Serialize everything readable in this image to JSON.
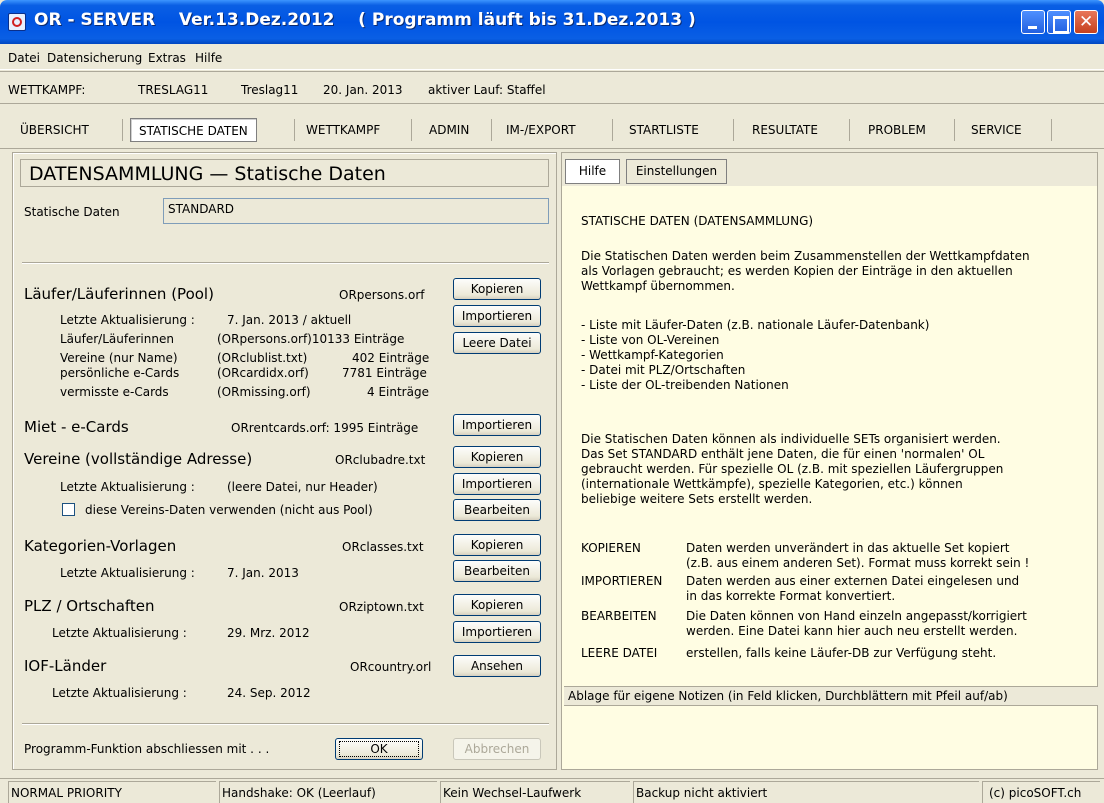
{
  "window": {
    "title": "OR - SERVER    Ver.13.Dez.2012    ( Programm läuft bis 31.Dez.2013 )"
  },
  "menu": [
    "Datei",
    "Datensicherung",
    "Extras",
    "Hilfe"
  ],
  "info": {
    "wettkampf_label": "WETTKAMPF:",
    "code": "TRESLAG11",
    "name": "Treslag11",
    "date": "20. Jan. 2013",
    "active_run": "aktiver Lauf: Staffel"
  },
  "tabs": [
    "ÜBERSICHT",
    "STATISCHE DATEN",
    "WETTKAMPF",
    "ADMIN",
    "IM-/EXPORT",
    "STARTLISTE",
    "RESULTATE",
    "PROBLEM",
    "SERVICE"
  ],
  "left": {
    "title": "DATENSAMMLUNG — Statische Daten",
    "static_label": "Statische Daten",
    "static_value": "STANDARD",
    "runners": {
      "heading": "Läufer/Läuferinnen (Pool)",
      "file": "ORpersons.orf",
      "update_label": "Letzte Aktualisierung :",
      "update_value": "7. Jan. 2013 / aktuell",
      "rows": [
        {
          "label": "Läufer/Läuferinnen",
          "file": "(ORpersons.orf)10133 Einträge"
        },
        {
          "label": "Vereine (nur Name)",
          "file": "(ORclublist.txt)",
          "count": "402 Einträge"
        },
        {
          "label": "persönliche e-Cards",
          "file": "(ORcardidx.orf)",
          "count": "7781 Einträge"
        },
        {
          "label": "vermisste e-Cards",
          "file": "(ORmissing.orf)",
          "count": "4 Einträge"
        }
      ]
    },
    "rental": {
      "heading": "Miet - e-Cards",
      "file": "ORrentcards.orf: 1995 Einträge"
    },
    "clubs": {
      "heading": "Vereine (vollständige Adresse)",
      "file": "ORclubadre.txt",
      "update_label": "Letzte Aktualisierung :",
      "update_value": "(leere Datei, nur Header)",
      "checkbox_label": "diese Vereins-Daten verwenden (nicht aus Pool)"
    },
    "categories": {
      "heading": "Kategorien-Vorlagen",
      "file": "ORclasses.txt",
      "update_label": "Letzte Aktualisierung :",
      "update_value": "7. Jan. 2013"
    },
    "plz": {
      "heading": "PLZ / Ortschaften",
      "file": "ORziptown.txt",
      "update_label": "Letzte Aktualisierung :",
      "update_value": "29. Mrz. 2012"
    },
    "iof": {
      "heading": "IOF-Länder",
      "file": "ORcountry.orl",
      "update_label": "Letzte Aktualisierung :",
      "update_value": "24. Sep. 2012"
    },
    "footer_label": "Programm-Funktion abschliessen mit . . .",
    "buttons": {
      "kopieren": "Kopieren",
      "importieren": "Importieren",
      "leere_datei": "Leere Datei",
      "bearbeiten": "Bearbeiten",
      "ansehen": "Ansehen",
      "ok": "OK",
      "abbrechen": "Abbrechen"
    }
  },
  "right": {
    "tabs": [
      "Hilfe",
      "Einstellungen"
    ],
    "help_title": "STATISCHE DATEN (DATENSAMMLUNG)",
    "para1": "Die Statischen Daten werden beim Zusammenstellen der Wettkampfdaten\nals Vorlagen gebraucht; es werden Kopien der Einträge in den aktuellen\nWettkampf übernommen.",
    "list": "- Liste mit Läufer-Daten (z.B. nationale Läufer-Datenbank)\n- Liste von OL-Vereinen\n- Wettkampf-Kategorien\n- Datei mit PLZ/Ortschaften\n- Liste der OL-treibenden Nationen",
    "para2": "Die Statischen Daten können als individuelle SETs organisiert werden.\nDas Set STANDARD enthält jene Daten, die für einen 'normalen' OL\ngebraucht werden. Für spezielle OL (z.B. mit speziellen Läufergruppen\n(internationale Wettkämpfe), spezielle Kategorien, etc.) können\nbeliebige weitere Sets erstellt werden.",
    "defs": [
      {
        "term": "KOPIEREN",
        "desc": "Daten werden unverändert in das aktuelle Set kopiert\n(z.B. aus einem anderen Set). Format muss korrekt sein !"
      },
      {
        "term": "IMPORTIEREN",
        "desc": "Daten werden aus einer externen Datei eingelesen und\nin das korrekte Format konvertiert."
      },
      {
        "term": "BEARBEITEN",
        "desc": "Die Daten können von Hand einzeln angepasst/korrigiert\nwerden. Eine Datei kann hier auch neu erstellt werden."
      },
      {
        "term": "LEERE DATEI",
        "desc": "erstellen, falls keine Läufer-DB zur Verfügung steht."
      }
    ],
    "notes_bar": "Ablage für eigene Notizen (in Feld klicken, Durchblättern mit Pfeil auf/ab)"
  },
  "status": [
    "NORMAL PRIORITY",
    "Handshake: OK (Leerlauf)",
    "Kein Wechsel-Laufwerk",
    "Backup nicht aktiviert",
    "(c) picoSOFT.ch"
  ]
}
